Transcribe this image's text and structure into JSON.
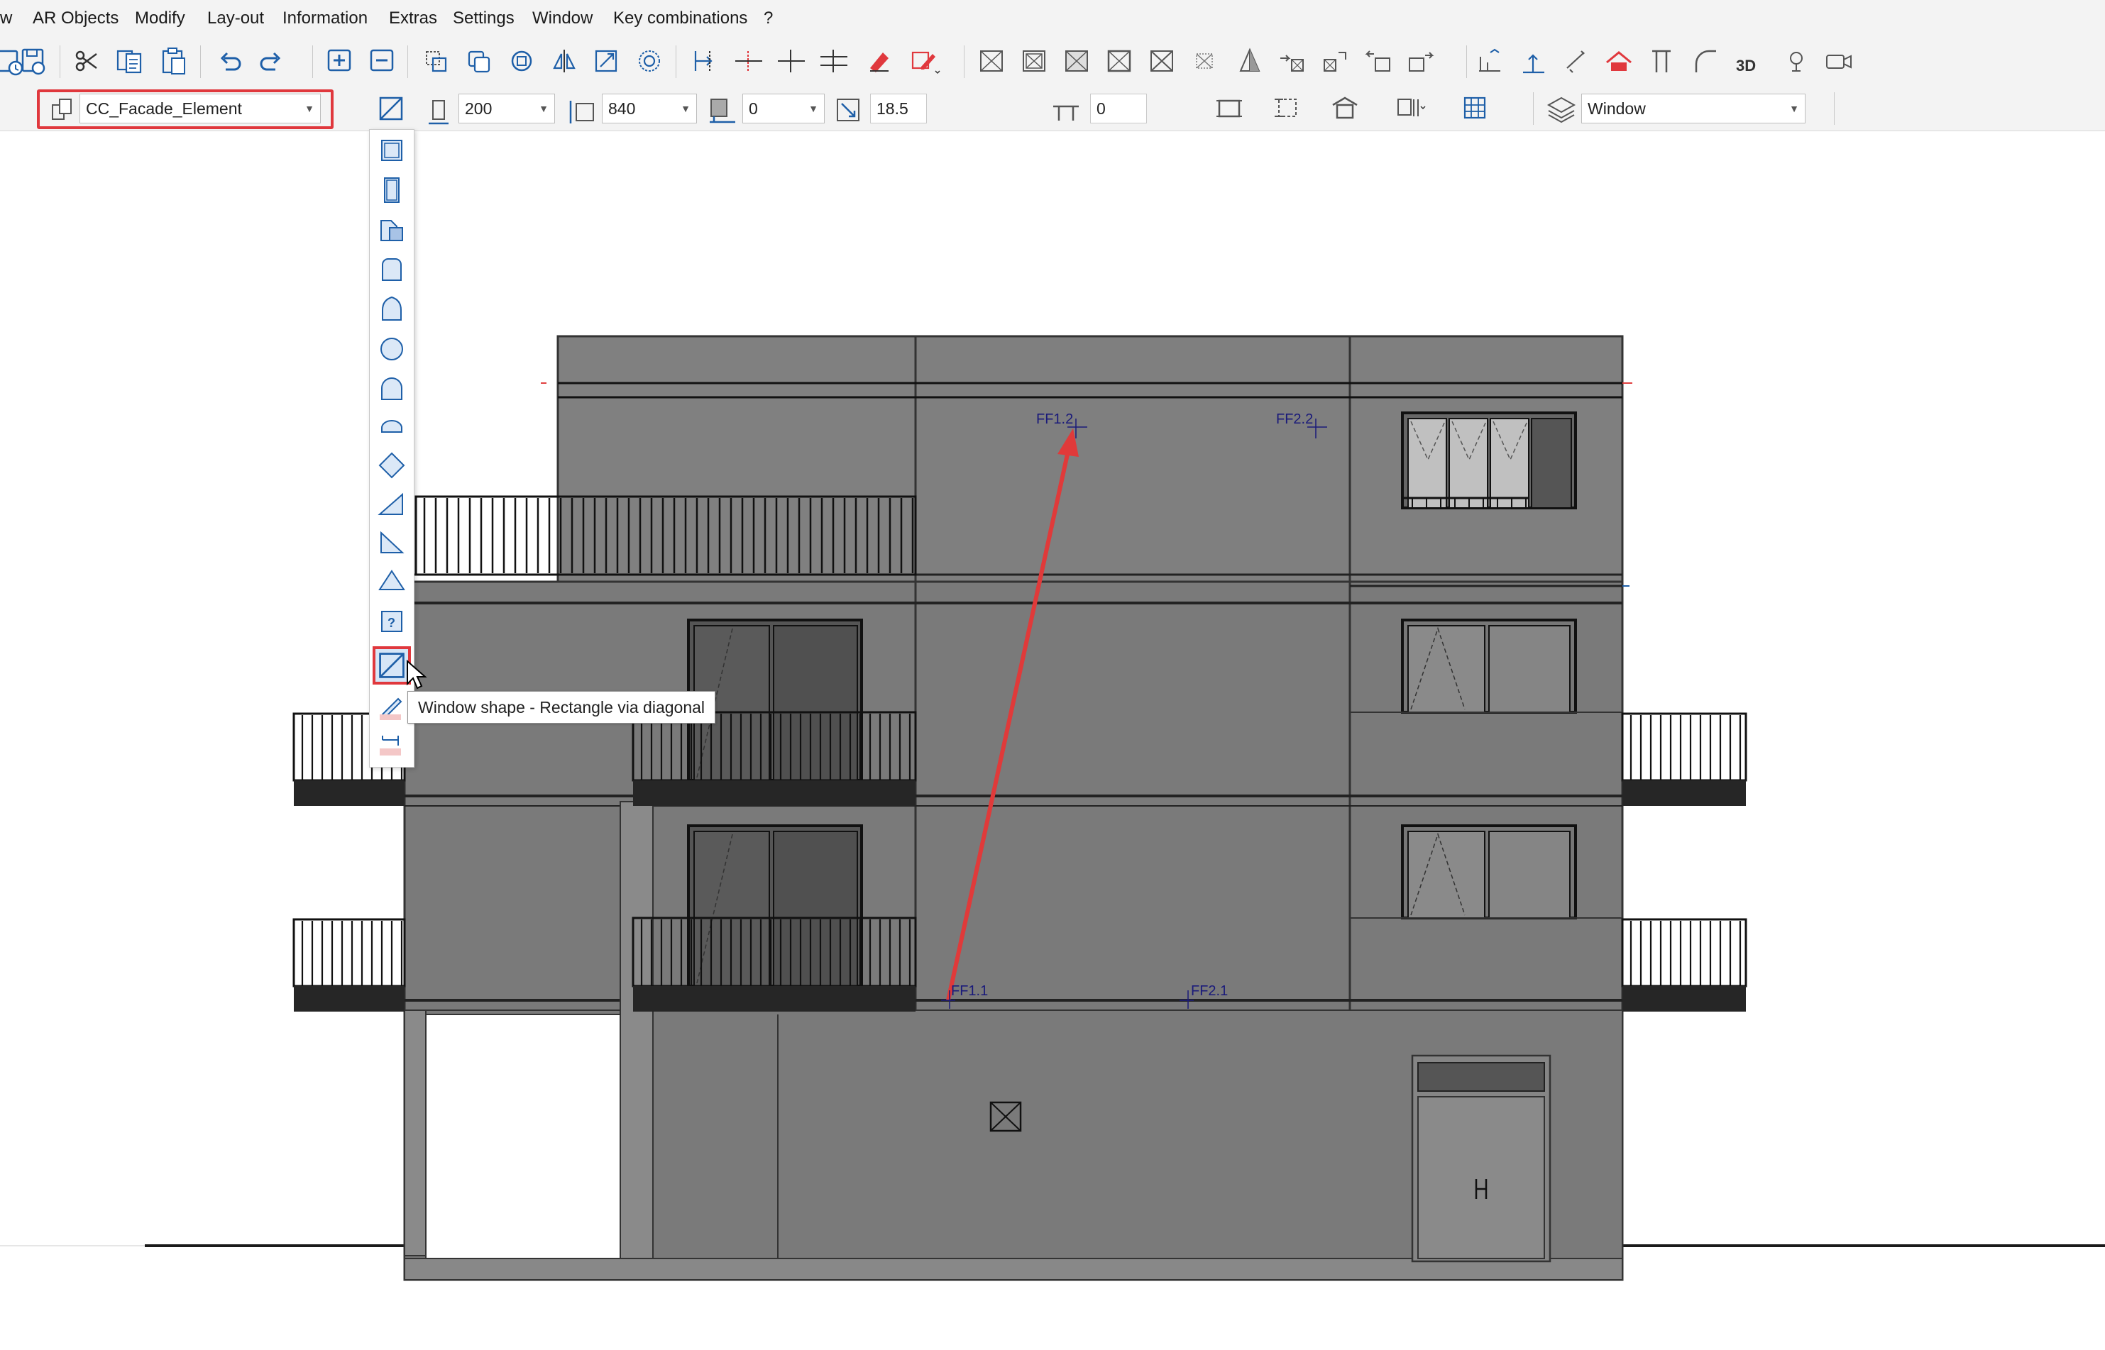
{
  "menubar": {
    "items": [
      {
        "label": "w"
      },
      {
        "label": "AR Objects"
      },
      {
        "label": "Modify"
      },
      {
        "label": "Lay-out"
      },
      {
        "label": "Information"
      },
      {
        "label": "Extras"
      },
      {
        "label": "Settings"
      },
      {
        "label": "Window"
      },
      {
        "label": "Key combinations"
      },
      {
        "label": "?"
      }
    ]
  },
  "toolbar": {
    "buttons": [
      "save-all",
      "save",
      "cut",
      "copy",
      "paste",
      "undo",
      "redo",
      "zoom-in",
      "zoom-out",
      "select-frame",
      "select-copy",
      "rotate",
      "mirror",
      "scale",
      "group",
      "snap-distance",
      "snap-perp",
      "snap-intersection",
      "snap-parallel",
      "eraser",
      "pencil-options",
      "window-x-1",
      "window-x-2",
      "window-x-3",
      "window-x-4",
      "window-x-5",
      "window-x-6",
      "pyramid",
      "copy-x-1",
      "copy-x-2",
      "copy-x-3",
      "copy-x-4",
      "dimension",
      "elevation",
      "options",
      "roof",
      "column",
      "arc",
      "3d",
      "light",
      "camera"
    ]
  },
  "propbar": {
    "object_type": "CC_Facade_Element",
    "width_value": "200",
    "height_value": "840",
    "offset_value": "0",
    "scale_value": "18.5",
    "sill_value": "0",
    "layer": "Window"
  },
  "tooltip": {
    "text": "Window shape - Rectangle via diagonal"
  },
  "drawing": {
    "labels": {
      "ff12": "FF1.2",
      "ff22": "FF2.2",
      "ff11": "FF1.1",
      "ff21": "FF2.1"
    },
    "colors": {
      "wall": "#7d7d7d",
      "arrow": "#e03a3a",
      "label": "#1a1a7a"
    }
  }
}
